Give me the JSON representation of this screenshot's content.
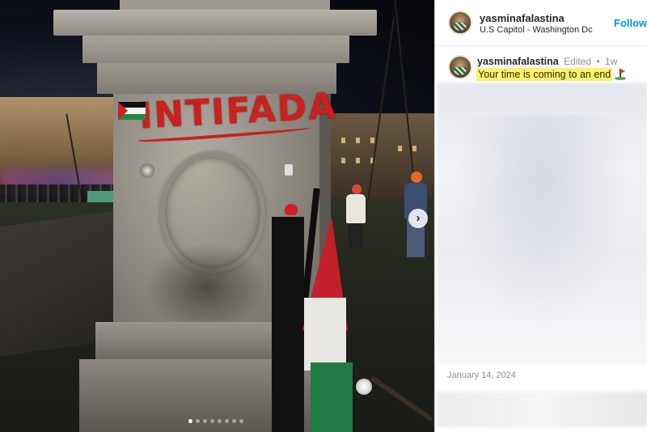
{
  "photo": {
    "graffiti_text": "INTIFADA",
    "carousel": {
      "total": 8,
      "active": 1
    },
    "next_icon": "chevron-right-icon"
  },
  "header": {
    "username": "yasminafalastina",
    "location": "U.S Capitol - Washington Dc",
    "follow_label": "Follow"
  },
  "caption": {
    "username": "yasminafalastina",
    "edited_label": "Edited",
    "separator": "•",
    "age": "1w",
    "text": "Your time is coming to an end",
    "emoji_icon": "golf-flag-icon"
  },
  "post": {
    "date": "January 14, 2024"
  },
  "colors": {
    "accent": "#0095f6",
    "highlight": "#fff268",
    "graffiti": "#c8211f"
  }
}
